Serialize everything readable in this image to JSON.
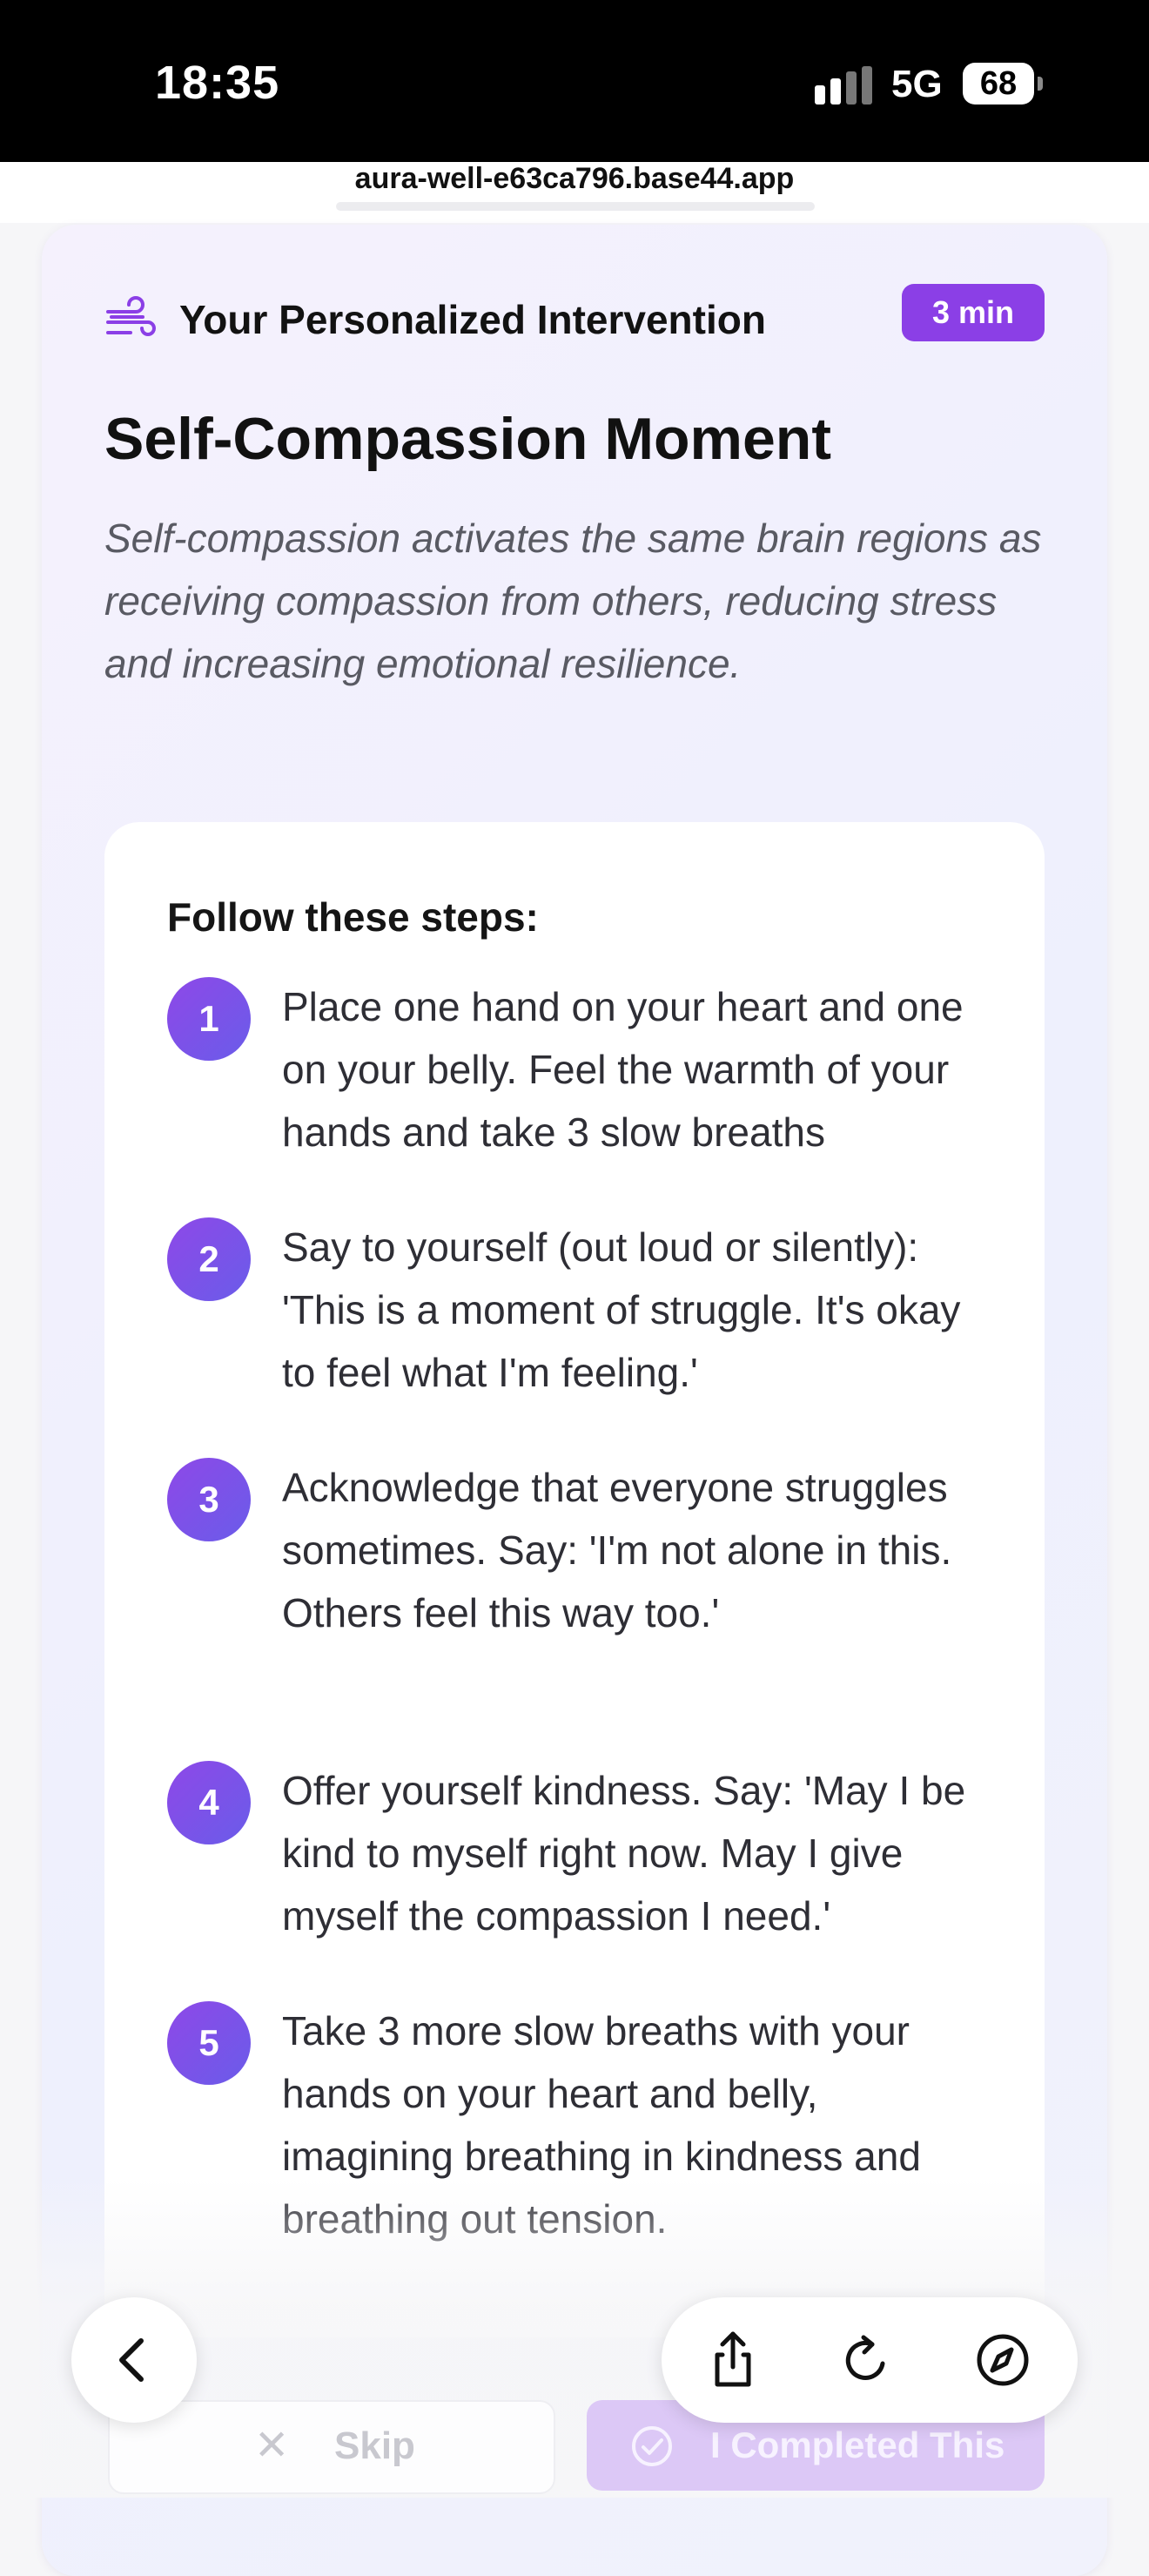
{
  "status_bar": {
    "time": "18:35",
    "network": "5G",
    "battery": "68"
  },
  "browser": {
    "url": "aura-well-e63ca796.base44.app"
  },
  "intervention": {
    "header_title": "Your Personalized Intervention",
    "duration_badge": "3 min",
    "title": "Self-Compassion Moment",
    "description": "Self-compassion activates the same brain regions as receiving compassion from others, reducing stress and increasing emotional resilience.",
    "steps_heading": "Follow these steps:",
    "steps": [
      {
        "number": "1",
        "text": "Place one hand on your heart and one on your belly. Feel the warmth of your hands and take 3 slow breaths"
      },
      {
        "number": "2",
        "text": "Say to yourself (out loud or silently): 'This is a moment of struggle. It's okay to feel what I'm feeling.'"
      },
      {
        "number": "3",
        "text": "Acknowledge that everyone struggles sometimes. Say: 'I'm not alone in this. Others feel this way too.'"
      },
      {
        "number": "4",
        "text": "Offer yourself kindness. Say: 'May I be kind to myself right now. May I give myself the compassion I need.'"
      },
      {
        "number": "5",
        "text": "Take 3 more slow breaths with your hands on your heart and belly, imagining breathing in kindness and breathing out tension."
      }
    ]
  },
  "actions": {
    "skip_label": "Skip",
    "complete_label": "I Completed This"
  },
  "icons": {
    "header": "wind-icon",
    "skip": "close-icon",
    "complete": "check-circle-icon",
    "back": "chevron-left-icon",
    "share": "share-icon",
    "reload": "reload-icon",
    "compass": "compass-icon"
  },
  "colors": {
    "accent": "#8b3fe6",
    "step_gradient_start": "#8e48e8",
    "step_gradient_end": "#6a5ce9"
  }
}
